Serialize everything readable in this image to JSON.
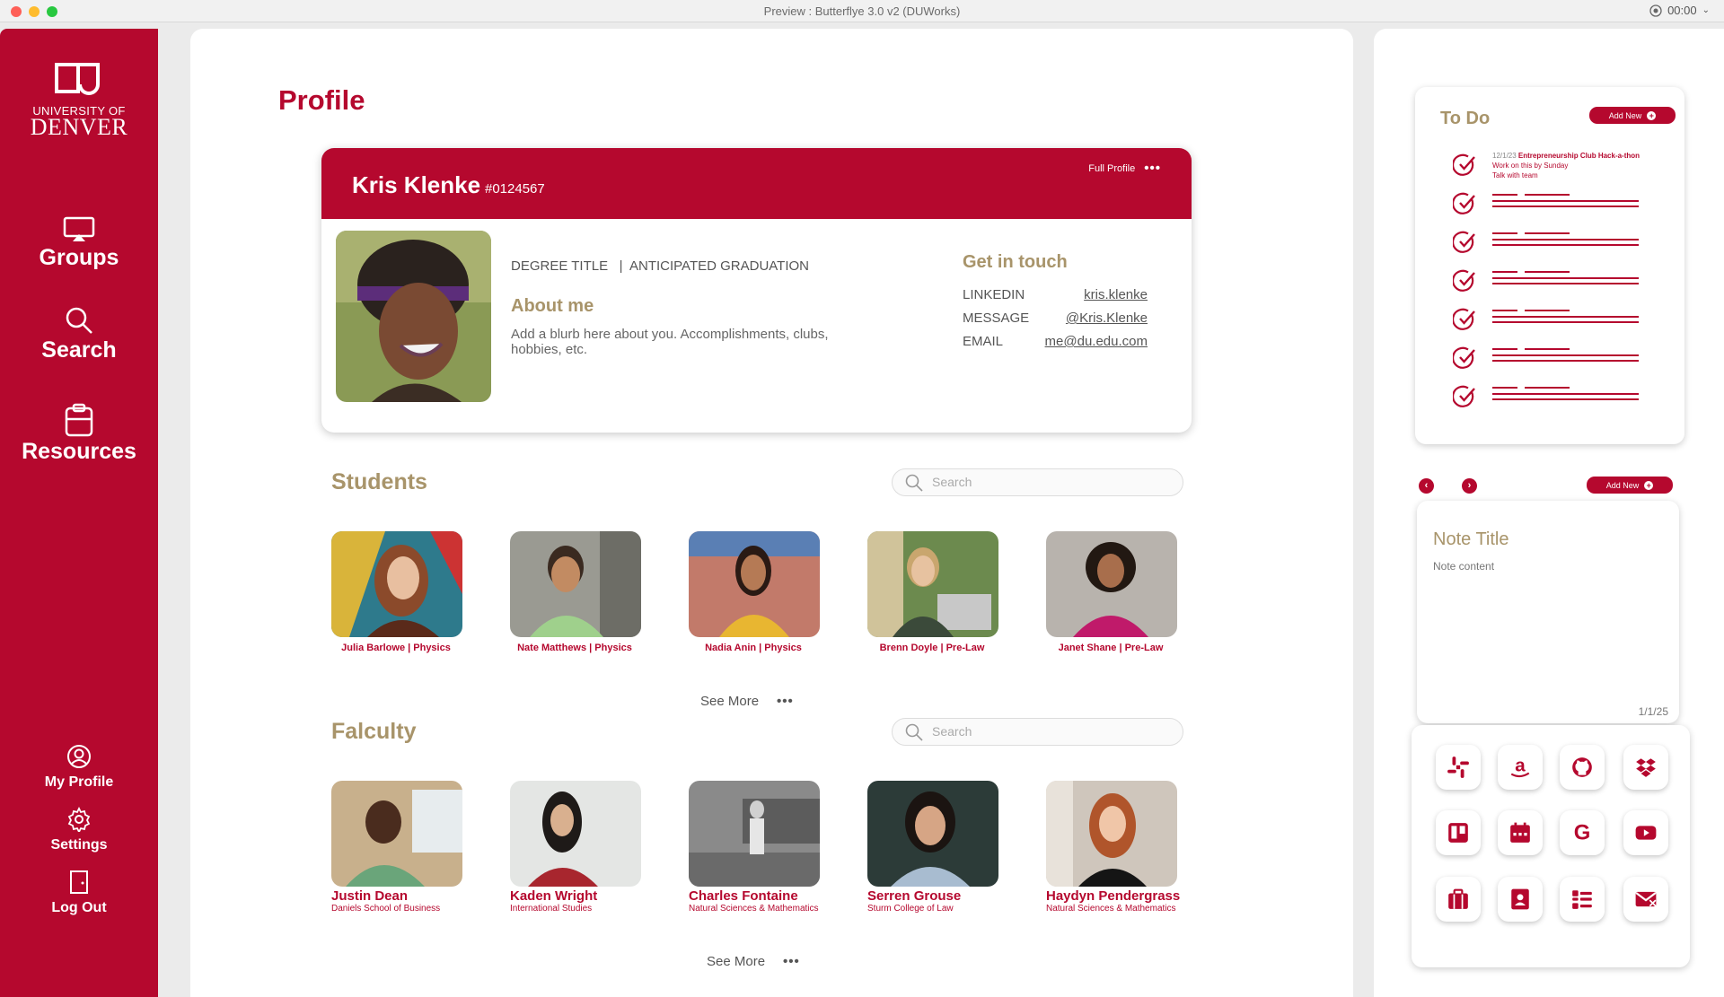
{
  "window": {
    "title": "Preview : Butterflye 3.0 v2 (DUWorks)",
    "timer": "00:00"
  },
  "brand": {
    "line1": "UNIVERSITY OF",
    "line2": "DENVER"
  },
  "nav": {
    "groups": "Groups",
    "search": "Search",
    "resources": "Resources",
    "my_profile": "My Profile",
    "settings": "Settings",
    "log_out": "Log Out"
  },
  "page": {
    "title": "Profile"
  },
  "profile": {
    "name": "Kris Klenke",
    "id": "#0124567",
    "full_profile": "Full Profile",
    "degree": "DEGREE TITLE   |  ANTICIPATED GRADUATION",
    "about_heading": "About me",
    "about_text": "Add a blurb here about you. Accomplishments, clubs, hobbies, etc.",
    "contact_heading": "Get in touch",
    "contacts": [
      {
        "label": "LINKEDIN",
        "value": "kris.klenke"
      },
      {
        "label": "MESSAGE",
        "value": "@Kris.Klenke"
      },
      {
        "label": "EMAIL",
        "value": "me@du.edu.com"
      }
    ]
  },
  "students": {
    "heading": "Students",
    "search_placeholder": "Search",
    "see_more": "See More",
    "items": [
      {
        "caption": "Julia Barlowe | Physics"
      },
      {
        "caption": "Nate Matthews | Physics"
      },
      {
        "caption": "Nadia Anin | Physics"
      },
      {
        "caption": "Brenn Doyle | Pre-Law"
      },
      {
        "caption": "Janet Shane | Pre-Law"
      }
    ]
  },
  "faculty": {
    "heading": "Falculty",
    "search_placeholder": "Search",
    "see_more": "See More",
    "items": [
      {
        "name": "Justin Dean",
        "dept": "Daniels School of Business"
      },
      {
        "name": "Kaden Wright",
        "dept": "International Studies"
      },
      {
        "name": "Charles Fontaine",
        "dept": "Natural Sciences & Mathematics"
      },
      {
        "name": "Serren Grouse",
        "dept": "Sturm College of Law"
      },
      {
        "name": "Haydyn Pendergrass",
        "dept": "Natural Sciences & Mathematics"
      }
    ]
  },
  "todo": {
    "heading": "To Do",
    "add_new": "Add New",
    "first": {
      "date": "12/1/23",
      "title": "Entrepreneurship Club Hack-a-thon",
      "line2": "Work on this by Sunday",
      "line3": "Talk with team"
    }
  },
  "note": {
    "add_new": "Add New",
    "title": "Note Title",
    "content": "Note content",
    "date": "1/1/25"
  },
  "apps": [
    "slack-icon",
    "amazon-icon",
    "github-icon",
    "dropbox-icon",
    "trello-icon",
    "calendar-icon",
    "google-icon",
    "youtube-icon",
    "briefcase-icon",
    "contacts-icon",
    "checklist-icon",
    "mail-icon"
  ],
  "colors": {
    "accent": "#b5082e",
    "gold": "#a8946a"
  }
}
